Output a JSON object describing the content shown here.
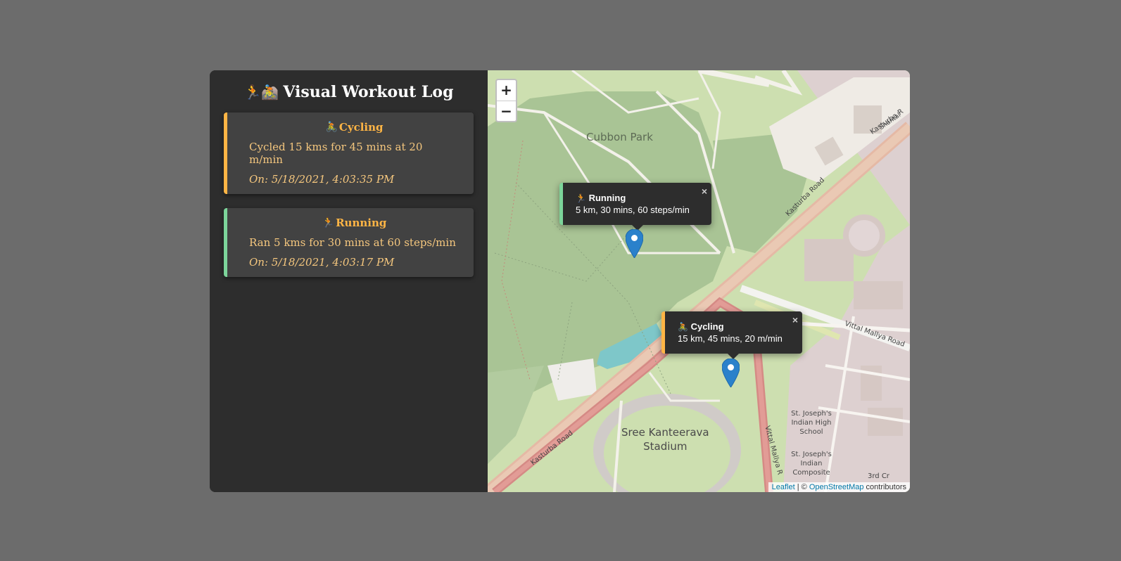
{
  "app": {
    "title_icons": "🏃🚵",
    "title": "Visual Workout Log"
  },
  "workouts": [
    {
      "type": "cycling",
      "icon": "🚴",
      "title": "Cycling",
      "description": "Cycled 15 kms for 45 mins at 20 m/min",
      "date": "On: 5/18/2021, 4:03:35 PM",
      "accent": "#ffb545"
    },
    {
      "type": "running",
      "icon": "🏃",
      "title": "Running",
      "description": "Ran 5 kms for 30 mins at 60 steps/min",
      "date": "On: 5/18/2021, 4:03:17 PM",
      "accent": "#7cd49a"
    }
  ],
  "map": {
    "zoom_in": "+",
    "zoom_out": "−",
    "labels": {
      "park": "Cubbon Park",
      "stadium_line1": "Sree Kanteerava",
      "stadium_line2": "Stadium",
      "school1": "St. Joseph's Indian High School",
      "school2": "St. Joseph's Indian Composite",
      "third_cross": "3rd Cr",
      "kasturba_road_1": "Kasturba Road",
      "kasturba_road_2": "Kasturba Road",
      "kasturba_road_3": "Kasturba R",
      "vittal_mallya_road": "Vittal Mallya Road",
      "vittal_mallya_road_2": "Vittal Mallya R",
      "shantala": "Shantal"
    },
    "popups": [
      {
        "type": "running",
        "icon": "🏃",
        "title": "Running",
        "text": "5 km, 30 mins, 60 steps/min",
        "close": "×"
      },
      {
        "type": "cycling",
        "icon": "🚴",
        "title": "Cycling",
        "text": "15 km, 45 mins, 20 m/min",
        "close": "×"
      }
    ],
    "attribution": {
      "leaflet": "Leaflet",
      "separator": " | © ",
      "osm": "OpenStreetMap",
      "contributors": " contributors"
    }
  }
}
